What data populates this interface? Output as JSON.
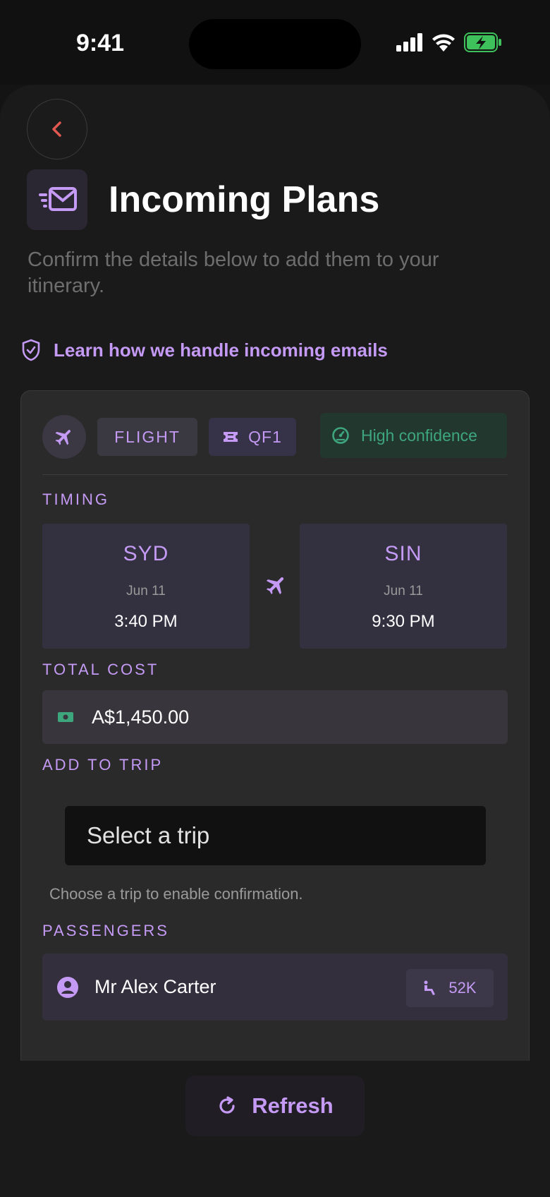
{
  "status_bar": {
    "time": "9:41"
  },
  "header": {
    "title": "Incoming Plans",
    "subtitle": "Confirm the details below to add them to your itinerary.",
    "learn_link": "Learn how we handle incoming emails"
  },
  "card": {
    "type_chip": "FLIGHT",
    "flight_code": "QF1",
    "confidence": "High confidence",
    "timing_label": "TIMING",
    "departure": {
      "code": "SYD",
      "date": "Jun 11",
      "time": "3:40 PM"
    },
    "arrival": {
      "code": "SIN",
      "date": "Jun 11",
      "time": "9:30 PM"
    },
    "cost_label": "TOTAL COST",
    "cost": "A$1,450.00",
    "add_label": "ADD TO TRIP",
    "trip_placeholder": "Select a trip",
    "trip_hint": "Choose a trip to enable confirmation.",
    "passengers_label": "PASSENGERS",
    "passengers": [
      {
        "name": "Mr Alex Carter",
        "seat": "52K"
      }
    ]
  },
  "footer": {
    "refresh_label": "Refresh"
  },
  "colors": {
    "accent": "#c49af5",
    "success": "#3ea67d",
    "back_arrow": "#e0584f"
  }
}
